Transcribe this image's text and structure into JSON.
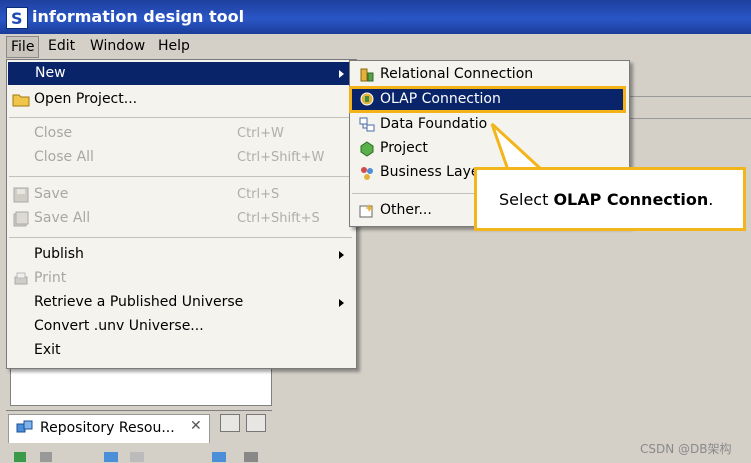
{
  "window": {
    "title": "information design tool"
  },
  "menubar": {
    "file": "File",
    "edit": "Edit",
    "window": "Window",
    "help": "Help"
  },
  "file_menu": {
    "new": "New",
    "open_project": "Open Project...",
    "close": "Close",
    "close_shortcut": "Ctrl+W",
    "close_all": "Close All",
    "close_all_shortcut": "Ctrl+Shift+W",
    "save": "Save",
    "save_shortcut": "Ctrl+S",
    "save_all": "Save All",
    "save_all_shortcut": "Ctrl+Shift+S",
    "publish": "Publish",
    "print": "Print",
    "retrieve": "Retrieve a Published Universe",
    "convert": "Convert .unv Universe...",
    "exit": "Exit"
  },
  "new_submenu": {
    "relational": "Relational Connection",
    "olap": "OLAP Connection",
    "data_foundation": "Data Foundatio",
    "project": "Project",
    "business_layer": "Business Laye",
    "other": "Other..."
  },
  "callout": {
    "prefix": "Select ",
    "bold": "OLAP Connection",
    "suffix": "."
  },
  "repo_panel": {
    "tab_label": "Repository Resou...",
    "close_glyph": "✕"
  },
  "watermark": "CSDN @DB架构",
  "colors": {
    "highlight": "#0a246a",
    "callout_border": "#f3b51c",
    "titlebar": "#2a56c6"
  }
}
